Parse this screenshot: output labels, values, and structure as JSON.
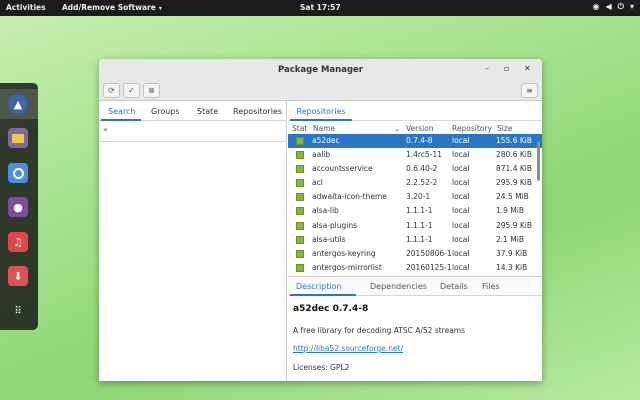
{
  "topbar": {
    "activities": "Activities",
    "app_menu": "Add/Remove Software",
    "clock": "Sat 17:57"
  },
  "dock": {
    "items": [
      "antergos-icon",
      "files-icon",
      "chromium-icon",
      "pidgin-icon",
      "music-icon",
      "installer-icon",
      "app-grid-icon"
    ]
  },
  "window": {
    "title": "Package Manager"
  },
  "left_tabs": [
    "Search",
    "Groups",
    "State",
    "Repositories"
  ],
  "right_tab": "Repositories",
  "columns": {
    "stat": "Stat",
    "name": "Name",
    "version": "Version",
    "repository": "Repository",
    "size": "Size"
  },
  "packages": [
    {
      "name": "a52dec",
      "version": "0.7.4-8",
      "repo": "local",
      "size": "155.6 KiB"
    },
    {
      "name": "aalib",
      "version": "1.4rc5-11",
      "repo": "local",
      "size": "280.6 KiB"
    },
    {
      "name": "accountsservice",
      "version": "0.6.40-2",
      "repo": "local",
      "size": "871.4 KiB"
    },
    {
      "name": "acl",
      "version": "2.2.52-2",
      "repo": "local",
      "size": "295.9 KiB"
    },
    {
      "name": "adwaita-icon-theme",
      "version": "3.20-1",
      "repo": "local",
      "size": "24.5 MiB"
    },
    {
      "name": "alsa-lib",
      "version": "1.1.1-1",
      "repo": "local",
      "size": "1.9 MiB"
    },
    {
      "name": "alsa-plugins",
      "version": "1.1.1-1",
      "repo": "local",
      "size": "295.9 KiB"
    },
    {
      "name": "alsa-utils",
      "version": "1.1.1-1",
      "repo": "local",
      "size": "2.1 MiB"
    },
    {
      "name": "antergos-keyring",
      "version": "20150806-1",
      "repo": "local",
      "size": "37.9 KiB"
    },
    {
      "name": "antergos-mirrorlist",
      "version": "20160125-1",
      "repo": "local",
      "size": "14.3 KiB"
    }
  ],
  "detail_tabs": [
    "Description",
    "Dependencies",
    "Details",
    "Files"
  ],
  "detail": {
    "heading": "a52dec  0.7.4-8",
    "description": "A free library for decoding ATSC A/52 streams",
    "link": "http://liba52.sourceforge.net/",
    "licenses": "Licenses: GPL2"
  }
}
